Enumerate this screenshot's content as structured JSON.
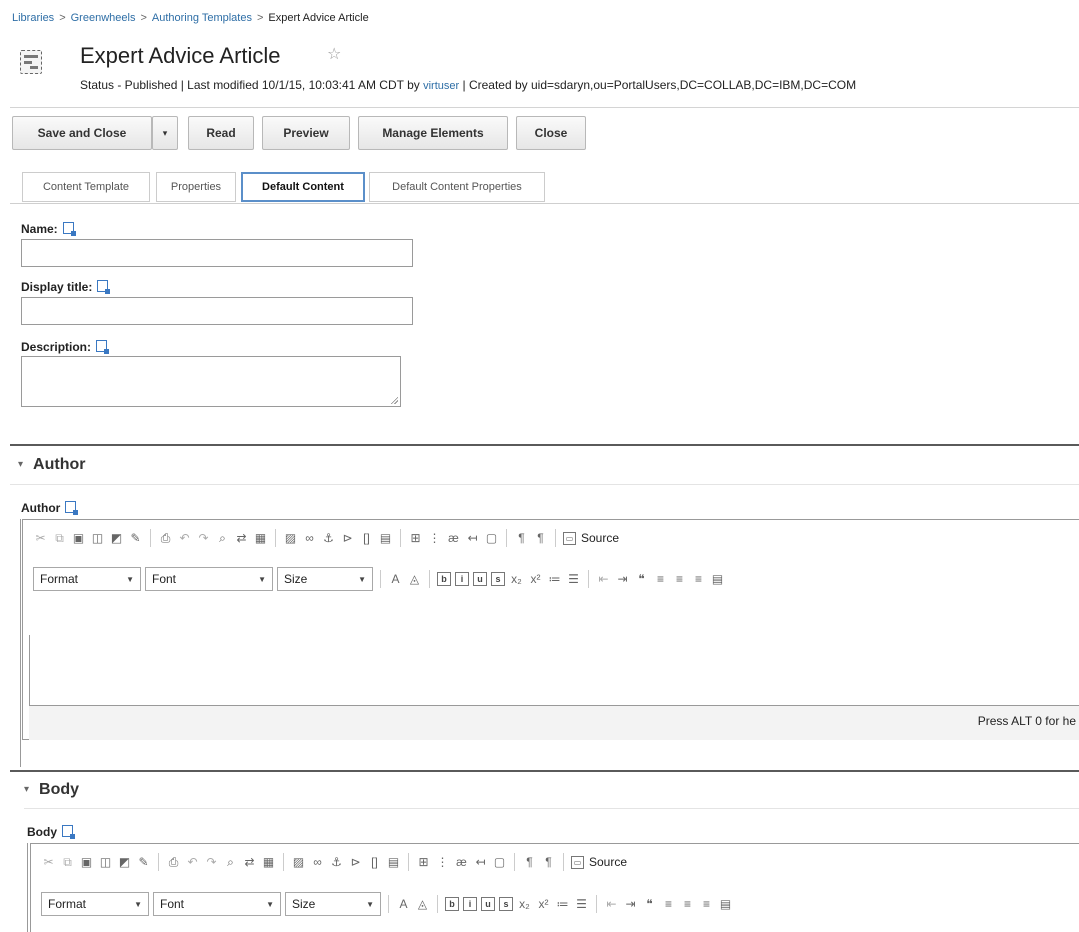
{
  "breadcrumb": {
    "items": [
      "Libraries",
      "Greenwheels",
      "Authoring Templates"
    ],
    "current": "Expert Advice Article",
    "separator": ">"
  },
  "header": {
    "title": "Expert Advice Article",
    "status_prefix": "Status - Published | Last modified 10/1/15, 10:03:41 AM CDT by ",
    "user": "virtuser",
    "status_suffix": " | Created by uid=sdaryn,ou=PortalUsers,DC=COLLAB,DC=IBM,DC=COM"
  },
  "toolbar": {
    "save_close": "Save and Close",
    "read": "Read",
    "preview": "Preview",
    "manage_elements": "Manage Elements",
    "close": "Close"
  },
  "tabs": {
    "content_template": "Content Template",
    "properties": "Properties",
    "default_content": "Default Content",
    "default_content_properties": "Default Content Properties",
    "active": "Default Content"
  },
  "form": {
    "name_label": "Name:",
    "name_value": "",
    "display_title_label": "Display title:",
    "display_title_value": "",
    "description_label": "Description:",
    "description_value": ""
  },
  "sections": {
    "author": {
      "title": "Author",
      "field_label": "Author",
      "format": "Format",
      "font": "Font",
      "size": "Size",
      "source": "Source",
      "statusbar": "Press ALT 0 for he"
    },
    "body": {
      "title": "Body",
      "field_label": "Body",
      "format": "Format",
      "font": "Font",
      "size": "Size",
      "source": "Source"
    }
  },
  "colors": {
    "link": "#2e6ea6",
    "active_tab_border": "#5b8fc9"
  }
}
